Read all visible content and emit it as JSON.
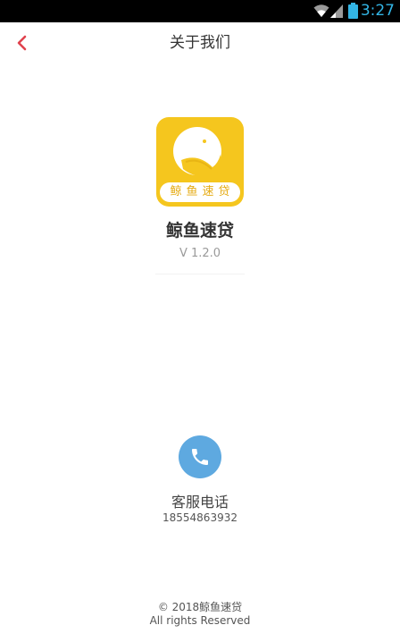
{
  "status_bar": {
    "time": "3:27",
    "background": "#000000",
    "accent": "#33b5e5",
    "icons": [
      "wifi-icon",
      "cell-signal-icon",
      "battery-icon"
    ]
  },
  "header": {
    "title": "关于我们",
    "back_icon": "chevron-left-icon",
    "back_color": "#e0434e"
  },
  "app": {
    "logo_label": "鲸鱼速贷",
    "name": "鲸鱼速贷",
    "version": "V 1.2.0",
    "logo_color": "#f5c61e"
  },
  "contact": {
    "icon": "phone-icon",
    "icon_color": "#5ea9e0",
    "label": "客服电话",
    "phone": "18554863932"
  },
  "footer": {
    "copyright": "© 2018鲸鱼速贷",
    "rights": "All rights Reserved"
  }
}
